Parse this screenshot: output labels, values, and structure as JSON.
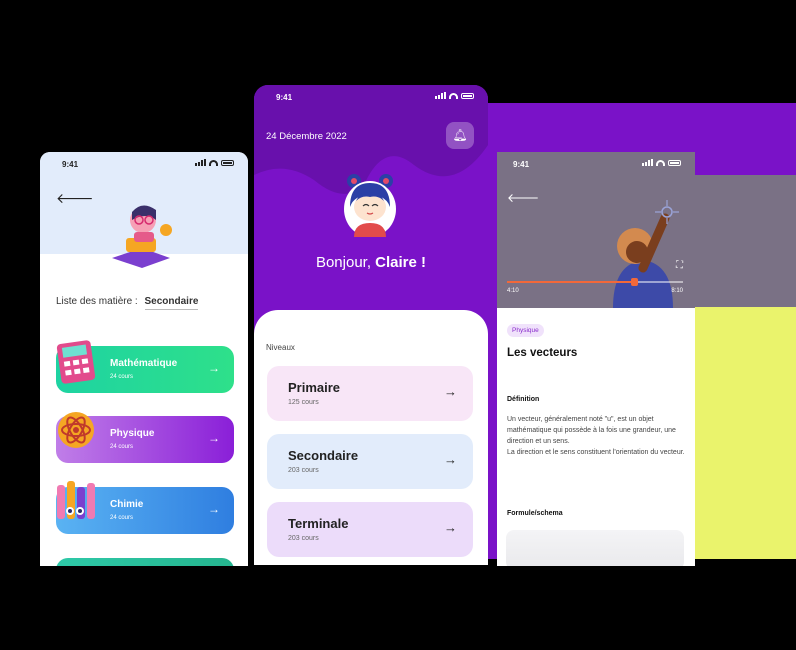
{
  "left_screen": {
    "time": "9:41",
    "back_icon": "arrow-left",
    "list_label": "Liste des matière :",
    "list_value": "Secondaire",
    "subjects": [
      {
        "name": "Mathématique",
        "count": "24 cours",
        "gradient": [
          "#1ed3a2",
          "#2ee08a"
        ]
      },
      {
        "name": "Physique",
        "count": "24 cours",
        "gradient": [
          "#b45be0",
          "#8a1fd8"
        ]
      },
      {
        "name": "Chimie",
        "count": "24 cours",
        "gradient": [
          "#4ea7f0",
          "#2f7ee0"
        ]
      }
    ]
  },
  "middle_screen": {
    "time": "9:41",
    "date": "24 Décembre 2022",
    "bell_icon": "bell",
    "greeting_prefix": "Bonjour,",
    "greeting_name": "Claire !",
    "section_label": "Niveaux",
    "levels": [
      {
        "name": "Primaire",
        "count": "125 cours",
        "color": "#f8e6f7"
      },
      {
        "name": "Secondaire",
        "count": "203 cours",
        "color": "#e2ecfb"
      },
      {
        "name": "Terminale",
        "count": "203 cours",
        "color": "#ecdcfa"
      }
    ],
    "accent": "#7a12c8"
  },
  "right_screen": {
    "time": "9:41",
    "back_icon": "arrow-left",
    "video_time_current": "4:10",
    "video_time_total": "8:10",
    "video_progress": 0.72,
    "expand_icon": "fullscreen",
    "tag": "Physique",
    "title": "Les vecteurs",
    "definition_heading": "Définition",
    "definition_text": "Un vecteur, généralement noté \"u\", est un objet mathématique qui possède à la fois une grandeur, une direction et un sens.",
    "definition_text_2": "La direction et le sens constituent l'orientation du vecteur.",
    "formula_heading": "Formule/schema"
  }
}
